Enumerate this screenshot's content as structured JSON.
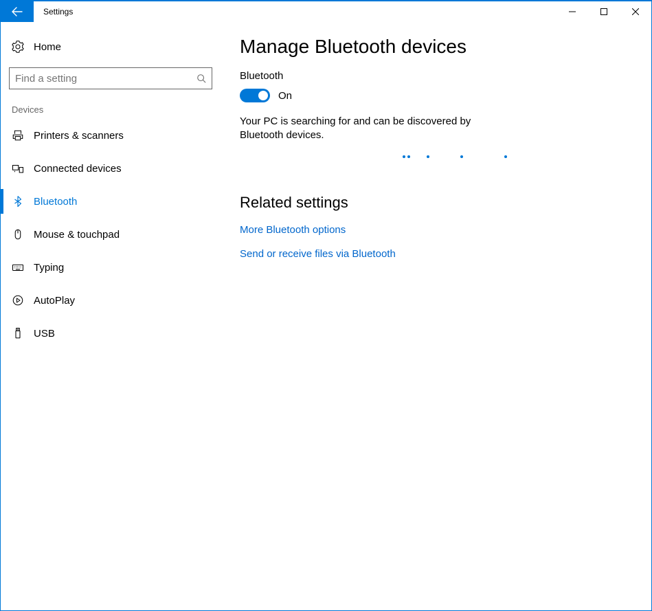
{
  "window": {
    "title": "Settings"
  },
  "sidebar": {
    "home_label": "Home",
    "search_placeholder": "Find a setting",
    "section_label": "Devices",
    "items": [
      {
        "label": "Printers & scanners",
        "icon": "printer-icon",
        "active": false
      },
      {
        "label": "Connected devices",
        "icon": "connected-devices-icon",
        "active": false
      },
      {
        "label": "Bluetooth",
        "icon": "bluetooth-icon",
        "active": true
      },
      {
        "label": "Mouse & touchpad",
        "icon": "mouse-icon",
        "active": false
      },
      {
        "label": "Typing",
        "icon": "keyboard-icon",
        "active": false
      },
      {
        "label": "AutoPlay",
        "icon": "autoplay-icon",
        "active": false
      },
      {
        "label": "USB",
        "icon": "usb-icon",
        "active": false
      }
    ]
  },
  "main": {
    "title": "Manage Bluetooth devices",
    "bluetooth_label": "Bluetooth",
    "toggle_state_label": "On",
    "status_text": "Your PC is searching for and can be discovered by Bluetooth devices.",
    "related_heading": "Related settings",
    "links": [
      "More Bluetooth options",
      "Send or receive files via Bluetooth"
    ]
  }
}
